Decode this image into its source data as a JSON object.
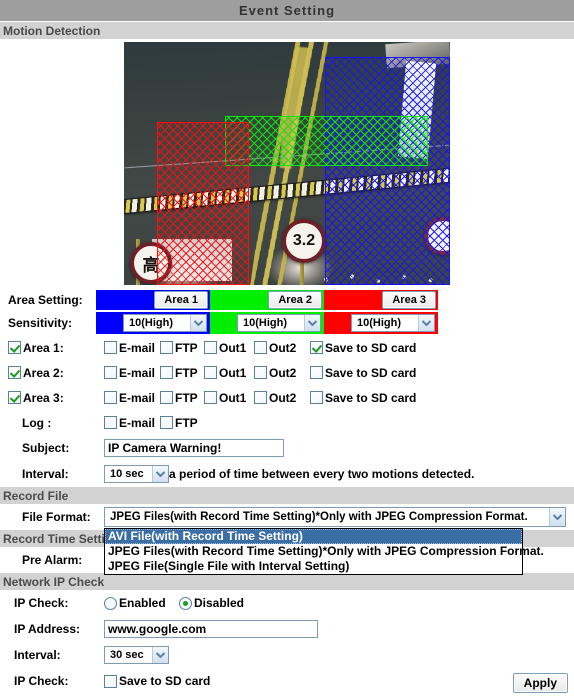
{
  "window": {
    "title": "Event Setting"
  },
  "sections": {
    "motion": "Motion Detection",
    "record_file": "Record File",
    "record_time": "Record Time Setting",
    "network_ip": "Network IP Check"
  },
  "video": {
    "signs": {
      "a": "高",
      "b": "3.2"
    },
    "zones": [
      {
        "name": "Area 1",
        "color": "#0000ff"
      },
      {
        "name": "Area 2",
        "color": "#00ee00"
      },
      {
        "name": "Area 3",
        "color": "#ff0000"
      }
    ]
  },
  "area_setting": {
    "label": "Area Setting:",
    "buttons": [
      {
        "label": "Area 1",
        "color": "#0000ff"
      },
      {
        "label": "Area 2",
        "color": "#00ee00"
      },
      {
        "label": "Area 3",
        "color": "#ff0000"
      }
    ]
  },
  "sensitivity": {
    "label": "Sensitivity:",
    "values": [
      "10(High)",
      "10(High)",
      "10(High)"
    ]
  },
  "areas": [
    {
      "label": "Area 1:",
      "enabled": true,
      "options": [
        {
          "label": "E-mail",
          "checked": false
        },
        {
          "label": "FTP",
          "checked": false
        },
        {
          "label": "Out1",
          "checked": false
        },
        {
          "label": "Out2",
          "checked": false
        },
        {
          "label": "Save to SD card",
          "checked": true
        }
      ]
    },
    {
      "label": "Area 2:",
      "enabled": true,
      "options": [
        {
          "label": "E-mail",
          "checked": false
        },
        {
          "label": "FTP",
          "checked": false
        },
        {
          "label": "Out1",
          "checked": false
        },
        {
          "label": "Out2",
          "checked": false
        },
        {
          "label": "Save to SD card",
          "checked": false
        }
      ]
    },
    {
      "label": "Area 3:",
      "enabled": true,
      "options": [
        {
          "label": "E-mail",
          "checked": false
        },
        {
          "label": "FTP",
          "checked": false
        },
        {
          "label": "Out1",
          "checked": false
        },
        {
          "label": "Out2",
          "checked": false
        },
        {
          "label": "Save to SD card",
          "checked": false
        }
      ]
    }
  ],
  "log": {
    "label": "Log :",
    "options": [
      {
        "label": "E-mail",
        "checked": false
      },
      {
        "label": "FTP",
        "checked": false
      }
    ]
  },
  "subject": {
    "label": "Subject:",
    "value": "IP Camera Warning!"
  },
  "interval_motion": {
    "label": "Interval:",
    "value": "10 sec",
    "note": "a period of time between every two motions detected."
  },
  "file_format": {
    "label": "File Format:",
    "value": "JPEG Files(with Record Time Setting)*Only with JPEG Compression Format.",
    "open": true,
    "options": [
      {
        "label": "AVI File(with Record Time Setting)",
        "selected": true
      },
      {
        "label": "JPEG Files(with Record Time Setting)*Only with JPEG Compression Format.",
        "selected": false
      },
      {
        "label": "JPEG File(Single File with Interval Setting)",
        "selected": false
      }
    ]
  },
  "pre_alarm": {
    "label": "Pre Alarm:"
  },
  "ip_check": {
    "label": "IP Check:",
    "enabled_label": "Enabled",
    "disabled_label": "Disabled",
    "enabled_selected": false,
    "disabled_selected": true
  },
  "ip_address": {
    "label": "IP Address:",
    "value": "www.google.com"
  },
  "interval_ip": {
    "label": "Interval:",
    "value": "30 sec"
  },
  "ip_check_sd": {
    "label": "IP Check:",
    "option": {
      "label": "Save to SD card",
      "checked": false
    }
  },
  "apply": {
    "label": "Apply"
  }
}
